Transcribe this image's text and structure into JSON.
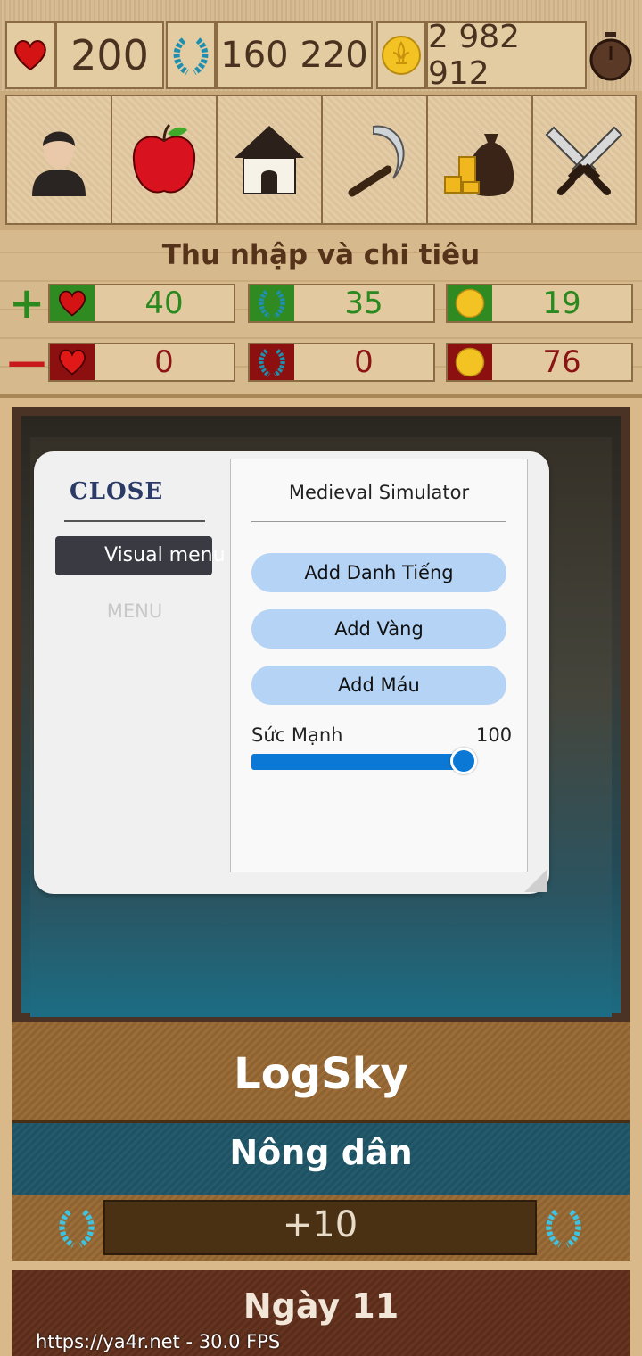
{
  "stats": {
    "health": "200",
    "reputation": "160 220",
    "gold": "2 982 912"
  },
  "icons": {
    "stats": [
      "heart-icon",
      "laurel-icon",
      "coin-icon",
      "stopwatch-icon"
    ],
    "actions": [
      "person-icon",
      "apple-icon",
      "house-icon",
      "sickle-icon",
      "money-bag-icon",
      "crossed-swords-icon"
    ]
  },
  "income": {
    "title": "Thu nhập và chi tiêu",
    "plus_sign": "+",
    "minus_sign": "—",
    "plus_health": "40",
    "plus_reputation": "35",
    "plus_gold": "19",
    "minus_health": "0",
    "minus_reputation": "0",
    "minus_gold": "76"
  },
  "menu": {
    "close_label": "CLOSE",
    "nav_visual": "Visual menu",
    "nav_menu": "MENU",
    "title": "Medieval Simulator",
    "btn_reputation": "Add Danh Tiếng",
    "btn_gold": "Add Vàng",
    "btn_health": "Add Máu",
    "slider_label": "Sức Mạnh",
    "slider_value": "100",
    "slider_fraction": 1.0
  },
  "player": {
    "name": "LogSky",
    "role": "Nông dân",
    "reputation_change": "+10",
    "day": "Ngày 11"
  },
  "overlay": {
    "fps_text": "https://ya4r.net - 30.0 FPS"
  },
  "colors": {
    "positive": "#2a8a1f",
    "negative": "#8a1414",
    "slider": "#0a78d4",
    "button": "#b5d3f5"
  }
}
